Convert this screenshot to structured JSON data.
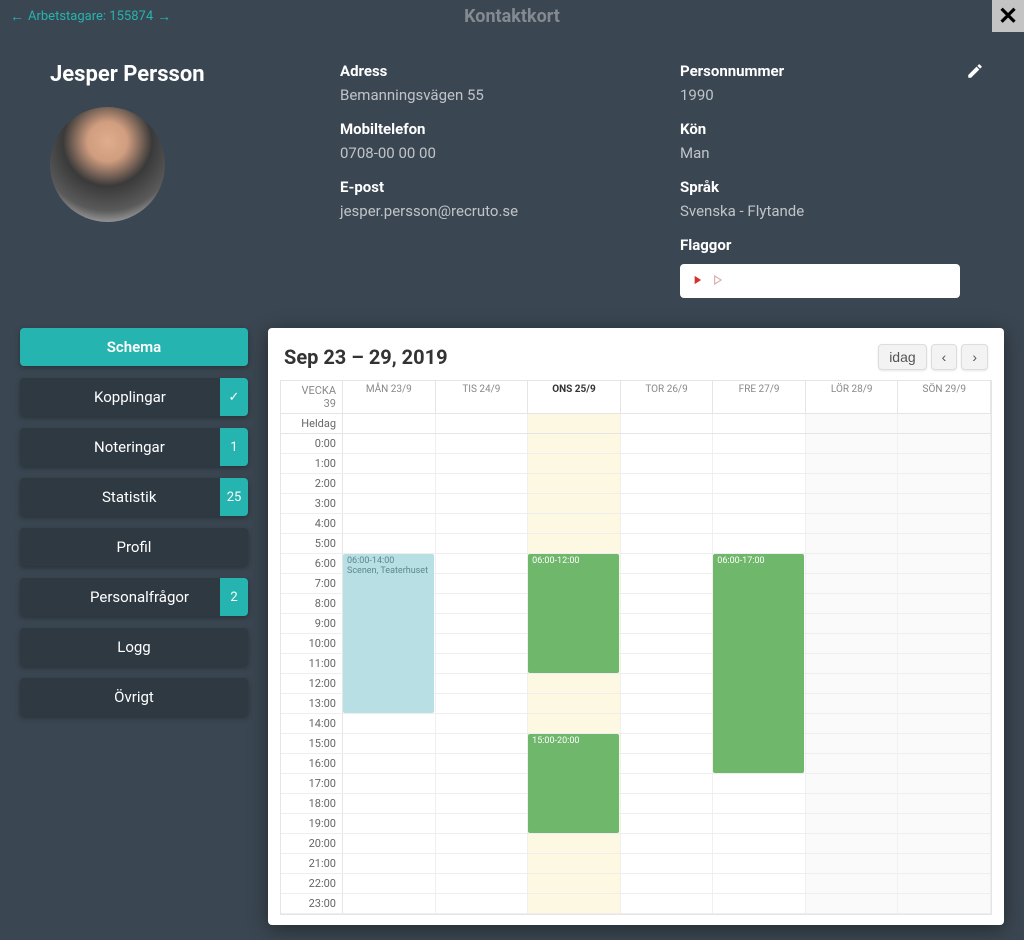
{
  "header": {
    "breadcrumb": "Arbetstagare: 155874",
    "title": "Kontaktkort"
  },
  "profile": {
    "name": "Jesper Persson",
    "address_label": "Adress",
    "address": "Bemanningsvägen 55",
    "mobile_label": "Mobiltelefon",
    "mobile": "0708-00 00 00",
    "email_label": "E-post",
    "email": "jesper.persson@recruto.se",
    "ssn_label": "Personnummer",
    "ssn": "1990",
    "gender_label": "Kön",
    "gender": "Man",
    "language_label": "Språk",
    "language": "Svenska - Flytande",
    "flags_label": "Flaggor"
  },
  "sidebar": {
    "schema": "Schema",
    "kopplingar": "Kopplingar",
    "noteringar": "Noteringar",
    "noteringar_badge": "1",
    "statistik": "Statistik",
    "statistik_badge": "25",
    "profil": "Profil",
    "personalfragor": "Personalfrågor",
    "personalfragor_badge": "2",
    "logg": "Logg",
    "ovrigt": "Övrigt"
  },
  "calendar": {
    "title": "Sep 23 – 29, 2019",
    "today": "idag",
    "week_label": "VECKA 39",
    "allday": "Heldag",
    "days": [
      "MÅN 23/9",
      "TIS 24/9",
      "ONS 25/9",
      "TOR 26/9",
      "FRE 27/9",
      "LÖR 28/9",
      "SÖN 29/9"
    ],
    "today_index": 2,
    "hours": [
      "0:00",
      "1:00",
      "2:00",
      "3:00",
      "4:00",
      "5:00",
      "6:00",
      "7:00",
      "8:00",
      "9:00",
      "10:00",
      "11:00",
      "12:00",
      "13:00",
      "14:00",
      "15:00",
      "16:00",
      "17:00",
      "18:00",
      "19:00",
      "20:00",
      "21:00",
      "22:00",
      "23:00"
    ],
    "events": [
      {
        "day": 0,
        "start": 6,
        "end": 14,
        "label": "06:00-14:00",
        "sub": "Scenen, Teaterhuset",
        "color": "blue"
      },
      {
        "day": 2,
        "start": 6,
        "end": 12,
        "label": "06:00-12:00",
        "color": "green"
      },
      {
        "day": 2,
        "start": 15,
        "end": 20,
        "label": "15:00-20:00",
        "color": "green"
      },
      {
        "day": 4,
        "start": 6,
        "end": 17,
        "label": "06:00-17:00",
        "color": "green"
      }
    ]
  }
}
